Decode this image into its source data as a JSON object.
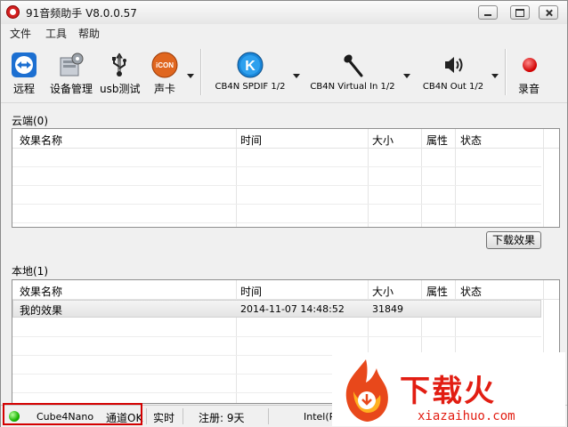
{
  "window": {
    "title": "91音频助手 V8.0.0.57"
  },
  "menu": [
    "文件",
    "工具",
    "帮助"
  ],
  "toolbar": {
    "remote": "远程",
    "device_manager": "设备管理",
    "usb_test": "usb测试",
    "sound_card": "声卡",
    "icon_badge": "iCON",
    "k_badge": "K",
    "spdif": "CB4N SPDIF 1/2",
    "virtual_in": "CB4N Virtual In 1/2",
    "out": "CB4N Out 1/2",
    "record": "录音"
  },
  "cloud": {
    "title": "云端(0)",
    "columns": [
      "效果名称",
      "时间",
      "大小",
      "属性",
      "状态"
    ],
    "rows": [],
    "download_button": "下载效果"
  },
  "local": {
    "title": "本地(1)",
    "columns": [
      "效果名称",
      "时间",
      "大小",
      "属性",
      "状态"
    ],
    "rows": [
      {
        "name": "我的效果",
        "time": "2014-11-07 14:48:52",
        "size": "31849",
        "attr": "",
        "status": ""
      }
    ]
  },
  "status": {
    "device": "Cube4Nano",
    "channel": "通道OK",
    "realtime": "实时",
    "register": "注册: 9天",
    "cpu": "Intel(R) Core(TM) i5"
  },
  "watermark": {
    "brand": "下载火",
    "url": "xiazaihuo.com"
  },
  "colors": {
    "accent_red": "#d40000",
    "status_ok": "#19b400",
    "brand_red": "#e21d12"
  }
}
